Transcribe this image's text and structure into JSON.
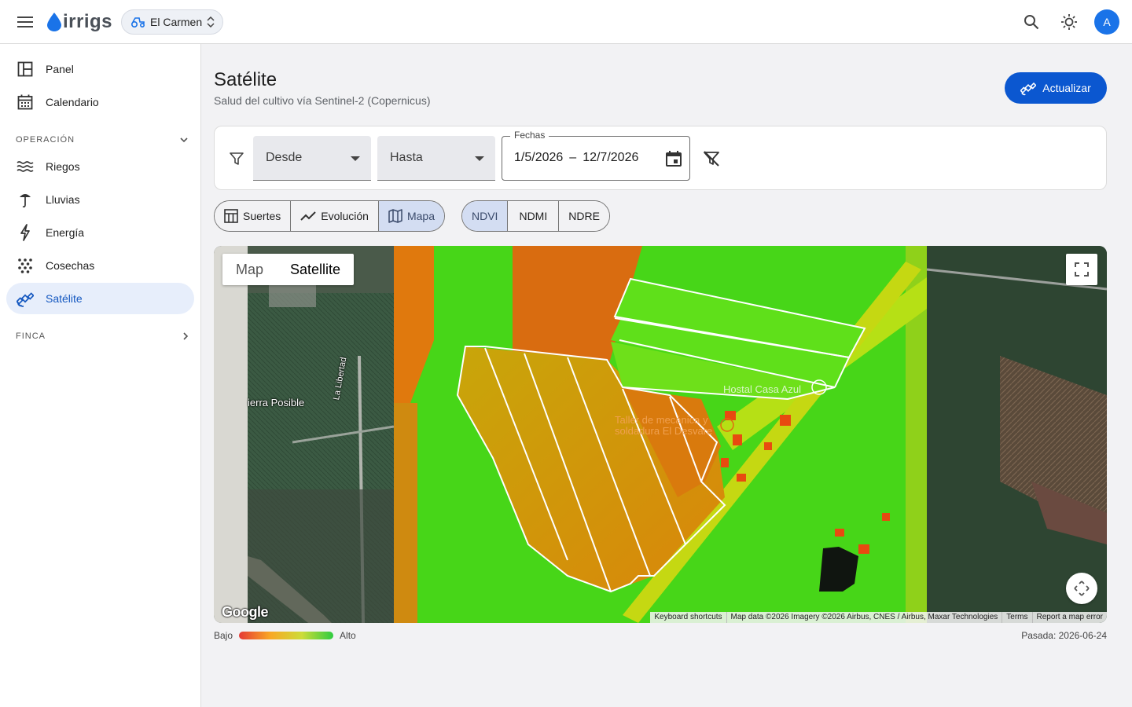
{
  "app": {
    "name": "irrigs",
    "farm": "El Carmen",
    "avatar_initial": "A"
  },
  "sidebar": {
    "items_top": [
      {
        "label": "Panel",
        "icon": "dashboard-icon"
      },
      {
        "label": "Calendario",
        "icon": "calendar-icon"
      }
    ],
    "section_operacion": "OPERACIÓN",
    "items_operacion": [
      {
        "label": "Riegos",
        "icon": "waves-icon"
      },
      {
        "label": "Lluvias",
        "icon": "rain-icon"
      },
      {
        "label": "Energía",
        "icon": "bolt-icon"
      },
      {
        "label": "Cosechas",
        "icon": "grain-icon"
      },
      {
        "label": "Satélite",
        "icon": "satellite-icon",
        "active": true
      }
    ],
    "section_finca": "FINCA"
  },
  "page": {
    "title": "Satélite",
    "subtitle": "Salud del cultivo vía Sentinel-2 (Copernicus)",
    "update_button": "Actualizar"
  },
  "filters": {
    "desde": "Desde",
    "hasta": "Hasta",
    "fechas_label": "Fechas",
    "date_from": "1/5/2026",
    "date_sep": "–",
    "date_to": "12/7/2026"
  },
  "views": [
    {
      "label": "Suertes",
      "icon": "table-icon"
    },
    {
      "label": "Evolución",
      "icon": "trend-icon"
    },
    {
      "label": "Mapa",
      "icon": "map-icon",
      "active": true
    }
  ],
  "indices": [
    {
      "label": "NDVI",
      "active": true
    },
    {
      "label": "NDMI"
    },
    {
      "label": "NDRE"
    }
  ],
  "map": {
    "type_map": "Map",
    "type_satellite": "Satellite",
    "labels": {
      "place1": "ierra Posible",
      "road1": "La Libertad",
      "place2": "Hostal Casa Azul",
      "place3_line1": "Taller de mecánica y",
      "place3_line2": "soldadura El Desvare"
    },
    "google": "Google",
    "attribution": {
      "shortcuts": "Keyboard shortcuts",
      "data": "Map data ©2026 Imagery ©2026 Airbus, CNES / Airbus, Maxar Technologies",
      "terms": "Terms",
      "report": "Report a map error"
    }
  },
  "legend": {
    "low": "Bajo",
    "high": "Alto",
    "pass": "Pasada: 2026-06-24"
  },
  "colors": {
    "accent": "#0b57d0",
    "active_nav_bg": "#e7eefb",
    "ndvi_low": "#e53935",
    "ndvi_high": "#2ecc40"
  }
}
